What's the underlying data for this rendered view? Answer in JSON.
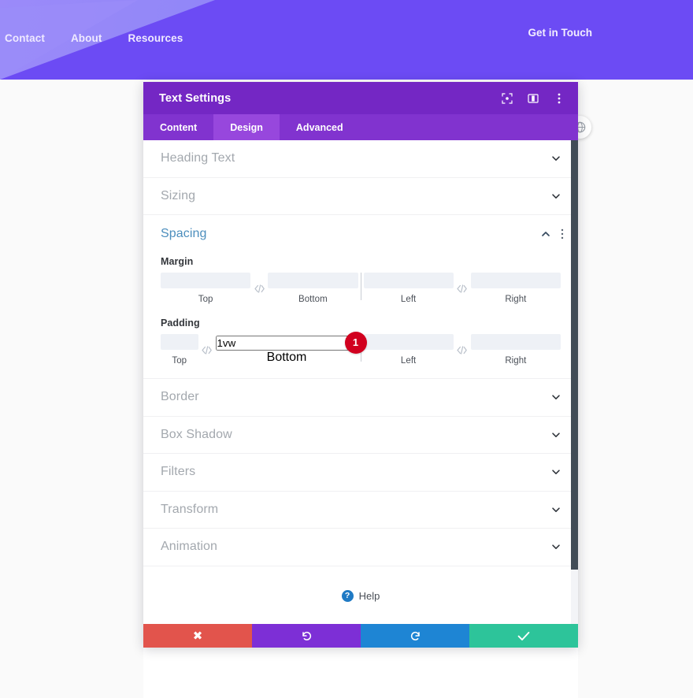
{
  "site": {
    "nav_items": [
      {
        "label": "Contact"
      },
      {
        "label": "About"
      },
      {
        "label": "Resources"
      }
    ],
    "cta_label": "Get in Touch",
    "header_bg": "#6C4BF4",
    "header_wedge": "#9a8cf9"
  },
  "modal": {
    "title": "Text Settings",
    "titlebar_bg": "#7427c4",
    "titlebar_icons": [
      {
        "name": "focus-icon"
      },
      {
        "name": "split-view-icon"
      },
      {
        "name": "more-vertical-icon"
      }
    ],
    "tabs": [
      {
        "label": "Content",
        "active": false
      },
      {
        "label": "Design",
        "active": true
      },
      {
        "label": "Advanced",
        "active": false
      }
    ],
    "tab_bar_bg": "#8133cf",
    "tab_active_bg": "#9747dd",
    "sections_above": [
      {
        "label": "Heading Text",
        "expanded": false
      },
      {
        "label": "Sizing",
        "expanded": false
      }
    ],
    "spacing": {
      "label": "Spacing",
      "expanded": true,
      "accent_color": "#4c8ebd",
      "groups": [
        {
          "label": "Margin",
          "fields": [
            {
              "sub": "Top",
              "value": "",
              "badge": null
            },
            {
              "sub": "Bottom",
              "value": "",
              "badge": null
            },
            {
              "sub": "Left",
              "value": "",
              "badge": null
            },
            {
              "sub": "Right",
              "value": "",
              "badge": null
            }
          ]
        },
        {
          "label": "Padding",
          "fields": [
            {
              "sub": "Top",
              "value": "",
              "badge": null
            },
            {
              "sub": "Bottom",
              "value": "1vw",
              "badge": "1"
            },
            {
              "sub": "Left",
              "value": "",
              "badge": null
            },
            {
              "sub": "Right",
              "value": "",
              "badge": null
            }
          ]
        }
      ]
    },
    "sections_below": [
      {
        "label": "Border",
        "expanded": false
      },
      {
        "label": "Box Shadow",
        "expanded": false
      },
      {
        "label": "Filters",
        "expanded": false
      },
      {
        "label": "Transform",
        "expanded": false
      },
      {
        "label": "Animation",
        "expanded": false
      }
    ],
    "help": {
      "label": "Help",
      "icon": "question-circle-icon",
      "icon_color": "#1f7ac4"
    },
    "actions": [
      {
        "name": "cancel-button",
        "icon": "close-icon",
        "color": "#e2544c"
      },
      {
        "name": "undo-button",
        "icon": "undo-icon",
        "color": "#7d2fd6"
      },
      {
        "name": "redo-button",
        "icon": "redo-icon",
        "color": "#1e85d4"
      },
      {
        "name": "save-button",
        "icon": "checkmark-icon",
        "color": "#2dc49a"
      }
    ],
    "badge_color": "#d1001f"
  }
}
